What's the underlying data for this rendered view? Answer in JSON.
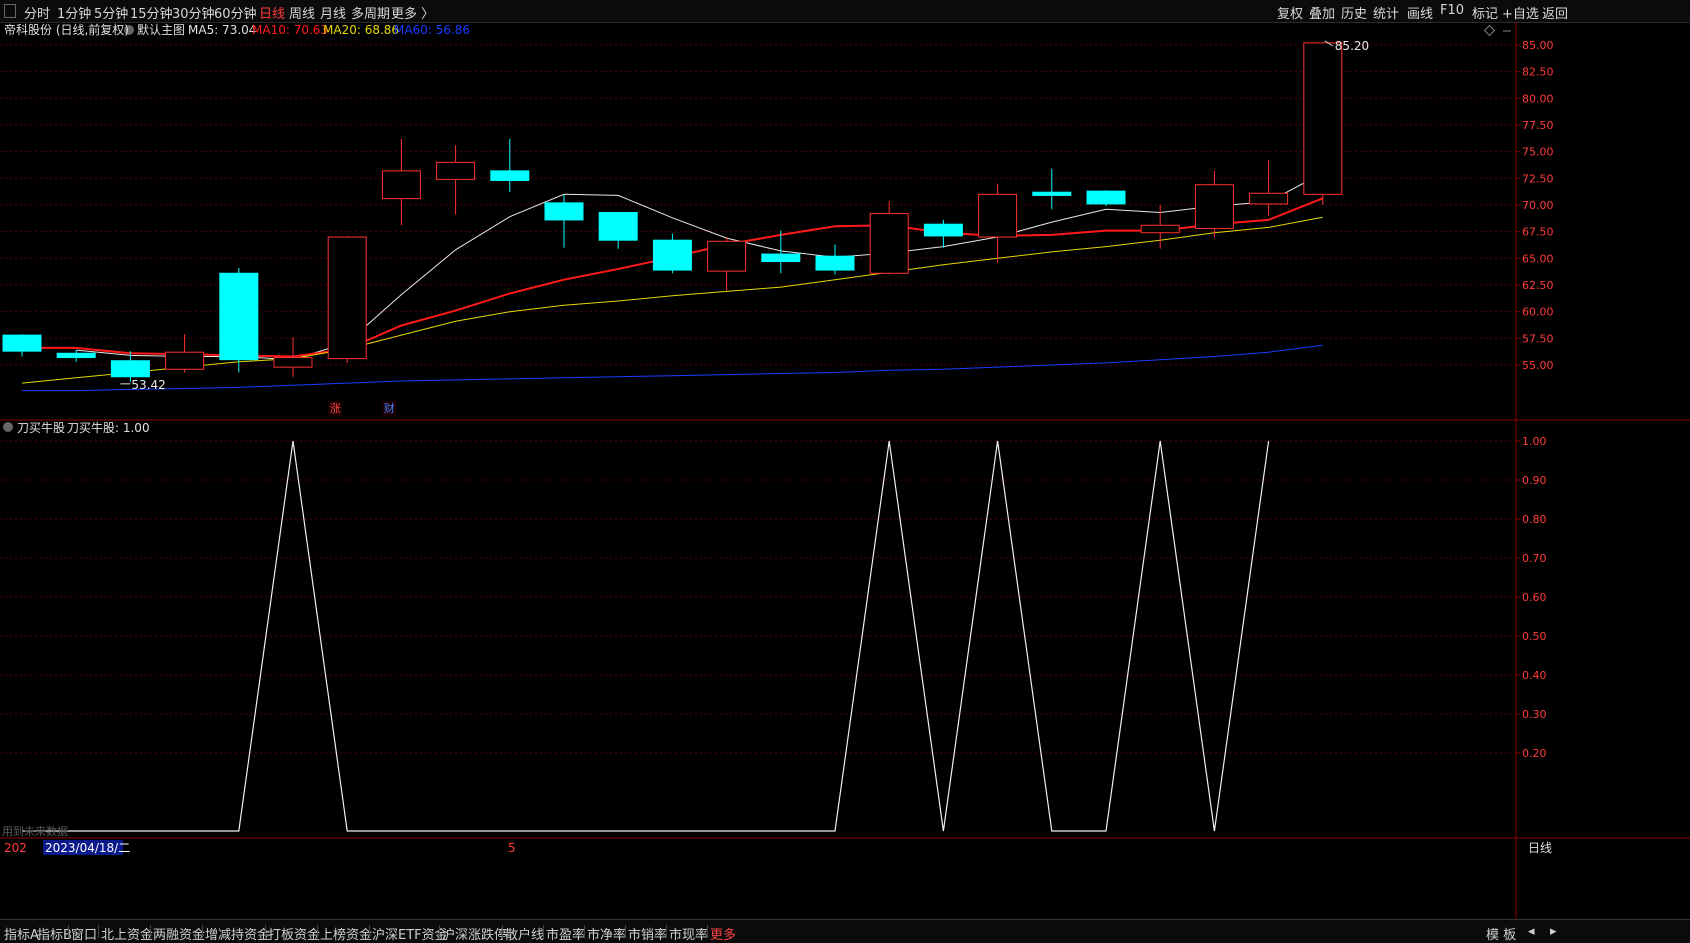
{
  "topbar": {
    "periods": [
      {
        "label": "分时",
        "active": false
      },
      {
        "label": "1分钟",
        "active": false
      },
      {
        "label": "5分钟",
        "active": false
      },
      {
        "label": "15分钟",
        "active": false
      },
      {
        "label": "30分钟",
        "active": false
      },
      {
        "label": "60分钟",
        "active": false
      },
      {
        "label": "日线",
        "active": true
      },
      {
        "label": "周线",
        "active": false
      },
      {
        "label": "月线",
        "active": false
      },
      {
        "label": "多周期",
        "active": false
      },
      {
        "label": "更多 〉",
        "active": false
      }
    ],
    "right_items": [
      "复权",
      "叠加",
      "历史",
      "统计",
      "画线",
      "F10",
      "标记",
      "+自选",
      "返回"
    ]
  },
  "main_header": {
    "stock": "帝科股份 (日线,前复权)",
    "template": "默认主图",
    "ma5": "MA5: 73.04",
    "ma10": "MA10: 70.63",
    "ma20": "MA20: 68.86",
    "ma60": "MA60: 56.86"
  },
  "sub_header": {
    "name": "刀买牛股",
    "value": "刀买牛股: 1.00"
  },
  "annotations": {
    "high": "85.20",
    "low": "53.42",
    "markers": [
      {
        "text": "涨",
        "index": 6
      },
      {
        "text": "财",
        "index": 7
      }
    ]
  },
  "date_axis": {
    "left_label": "202",
    "date": "2023/04/18/二",
    "mid_label": "5",
    "right_label": "日线",
    "watermark_note": "用到未来数据"
  },
  "bottombar": {
    "items": [
      "指标A",
      "指标B",
      "窗口",
      "北上资金",
      "两融资金",
      "增减持资金",
      "打板资金",
      "上榜资金",
      "沪深ETF资金",
      "沪深涨跌停",
      "散户线",
      "市盈率",
      "市净率",
      "市销率",
      "市现率",
      "更多"
    ],
    "highlight": "更多",
    "right_items": [
      "模 板",
      "◂",
      "▸"
    ]
  },
  "colors": {
    "up": "#ff3030",
    "down": "#00ffff",
    "ma5": "#e8e8e8",
    "ma10": "#ff1a1a",
    "ma20": "#e6d800",
    "ma60": "#1a3cff",
    "grid": "#5a0000",
    "axis_text": "#ff3b3b",
    "indicator": "#f0f0f0"
  },
  "chart_data": [
    {
      "type": "candlestick",
      "title": "帝科股份 (日线,前复权)",
      "ylim": [
        52.5,
        86.0
      ],
      "y_ticks": [
        "85.00",
        "82.50",
        "80.00",
        "77.50",
        "75.00",
        "72.50",
        "70.00",
        "67.50",
        "65.00",
        "62.50",
        "60.00",
        "57.50",
        "55.00"
      ],
      "candles": [
        {
          "o": 57.8,
          "h": 57.9,
          "l": 55.8,
          "c": 56.3
        },
        {
          "o": 56.1,
          "h": 56.4,
          "l": 55.3,
          "c": 55.7
        },
        {
          "o": 55.4,
          "h": 56.3,
          "l": 53.42,
          "c": 53.9
        },
        {
          "o": 54.6,
          "h": 57.9,
          "l": 54.3,
          "c": 56.2
        },
        {
          "o": 63.6,
          "h": 64.1,
          "l": 54.3,
          "c": 55.5
        },
        {
          "o": 54.8,
          "h": 57.6,
          "l": 53.9,
          "c": 55.7
        },
        {
          "o": 55.6,
          "h": 67.1,
          "l": 55.2,
          "c": 67.0
        },
        {
          "o": 70.6,
          "h": 76.2,
          "l": 68.1,
          "c": 73.2
        },
        {
          "o": 72.4,
          "h": 75.6,
          "l": 69.1,
          "c": 74.0
        },
        {
          "o": 73.2,
          "h": 76.2,
          "l": 71.2,
          "c": 72.3
        },
        {
          "o": 70.2,
          "h": 71.0,
          "l": 66.0,
          "c": 68.6
        },
        {
          "o": 69.3,
          "h": 69.3,
          "l": 65.9,
          "c": 66.7
        },
        {
          "o": 66.7,
          "h": 67.3,
          "l": 63.6,
          "c": 63.9
        },
        {
          "o": 63.8,
          "h": 67.0,
          "l": 62.0,
          "c": 66.6
        },
        {
          "o": 65.4,
          "h": 67.6,
          "l": 63.6,
          "c": 64.7
        },
        {
          "o": 65.2,
          "h": 66.3,
          "l": 63.5,
          "c": 63.9
        },
        {
          "o": 63.6,
          "h": 70.4,
          "l": 63.5,
          "c": 69.2
        },
        {
          "o": 68.2,
          "h": 68.6,
          "l": 66.0,
          "c": 67.1
        },
        {
          "o": 67.0,
          "h": 72.0,
          "l": 64.6,
          "c": 71.0
        },
        {
          "o": 71.2,
          "h": 73.4,
          "l": 69.6,
          "c": 70.9
        },
        {
          "o": 71.3,
          "h": 71.4,
          "l": 69.9,
          "c": 70.1
        },
        {
          "o": 67.4,
          "h": 70.0,
          "l": 65.9,
          "c": 68.1
        },
        {
          "o": 67.8,
          "h": 73.2,
          "l": 67.0,
          "c": 71.9
        },
        {
          "o": 70.1,
          "h": 74.2,
          "l": 69.0,
          "c": 71.1
        },
        {
          "o": 71.0,
          "h": 85.2,
          "l": 70.0,
          "c": 85.2
        }
      ],
      "series": [
        {
          "name": "MA5",
          "values": [
            null,
            56.4,
            55.9,
            55.8,
            55.8,
            55.5,
            57.1,
            61.6,
            65.8,
            68.9,
            71.0,
            70.9,
            68.8,
            66.9,
            65.7,
            65.1,
            65.5,
            66.1,
            67.0,
            68.4,
            69.6,
            69.3,
            69.9,
            70.3,
            73.0
          ]
        },
        {
          "name": "MA10",
          "values": [
            56.6,
            56.6,
            56.1,
            56.0,
            55.9,
            55.8,
            56.5,
            58.7,
            60.1,
            61.7,
            63.0,
            64.0,
            65.1,
            66.3,
            67.2,
            68.0,
            68.1,
            67.4,
            67.1,
            67.2,
            67.6,
            67.6,
            68.2,
            68.6,
            70.63
          ]
        },
        {
          "name": "MA20",
          "values": [
            53.3,
            53.8,
            54.3,
            54.8,
            55.3,
            55.6,
            56.5,
            57.8,
            59.1,
            60.0,
            60.6,
            61.0,
            61.5,
            61.9,
            62.3,
            63.0,
            63.7,
            64.4,
            65.0,
            65.6,
            66.1,
            66.7,
            67.4,
            67.9,
            68.86
          ]
        },
        {
          "name": "MA60",
          "values": [
            52.6,
            52.6,
            52.7,
            52.8,
            52.9,
            53.1,
            53.3,
            53.5,
            53.6,
            53.7,
            53.8,
            53.9,
            54.0,
            54.1,
            54.2,
            54.3,
            54.5,
            54.6,
            54.8,
            55.0,
            55.2,
            55.5,
            55.8,
            56.2,
            56.86
          ]
        }
      ]
    },
    {
      "type": "line",
      "title": "刀买牛股",
      "ylim": [
        0,
        1.0
      ],
      "y_ticks": [
        "1.00",
        "0.90",
        "0.80",
        "0.70",
        "0.60",
        "0.50",
        "0.40",
        "0.30",
        "0.20"
      ],
      "series": [
        {
          "name": "刀买牛股",
          "values": [
            0,
            0,
            0,
            0,
            0,
            1,
            0,
            0,
            0,
            0,
            0,
            0,
            0,
            0,
            0,
            0,
            1,
            0,
            1,
            0,
            0,
            1,
            0,
            1
          ]
        }
      ]
    }
  ]
}
